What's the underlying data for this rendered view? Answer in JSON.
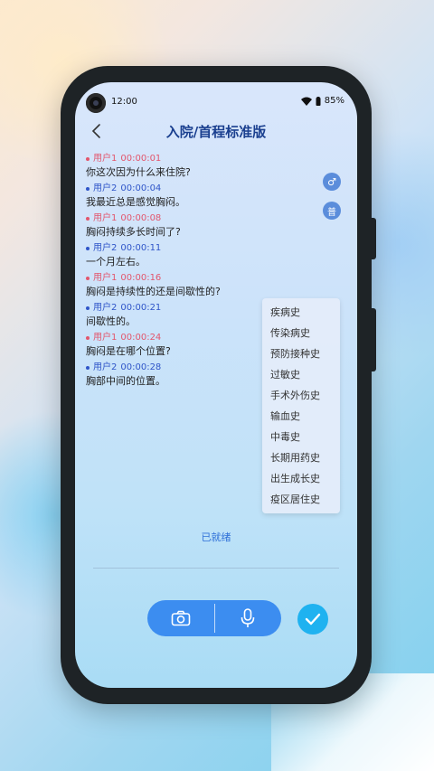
{
  "status_bar": {
    "time": "12:00",
    "battery": "85%"
  },
  "header": {
    "title": "入院/首程标准版"
  },
  "messages": [
    {
      "speaker": "用户1",
      "time": "00:00:01",
      "text": "你这次因为什么来住院?"
    },
    {
      "speaker": "用户2",
      "time": "00:00:04",
      "text": "我最近总是感觉胸闷。"
    },
    {
      "speaker": "用户1",
      "time": "00:00:08",
      "text": "胸闷持续多长时间了?"
    },
    {
      "speaker": "用户2",
      "time": "00:00:11",
      "text": "一个月左右。"
    },
    {
      "speaker": "用户1",
      "time": "00:00:16",
      "text": "胸闷是持续性的还是间歇性的?"
    },
    {
      "speaker": "用户2",
      "time": "00:00:21",
      "text": "间歇性的。"
    },
    {
      "speaker": "用户1",
      "time": "00:00:24",
      "text": "胸闷是在哪个位置?"
    },
    {
      "speaker": "用户2",
      "time": "00:00:28",
      "text": "胸部中间的位置。"
    }
  ],
  "side_icons": {
    "gender_symbol": "♂",
    "general_symbol": "普"
  },
  "history_menu": [
    "疾病史",
    "传染病史",
    "预防接种史",
    "过敏史",
    "手术外伤史",
    "输血史",
    "中毒史",
    "长期用药史",
    "出生成长史",
    "疫区居住史"
  ],
  "status_text": "已就绪",
  "colors": {
    "user1": "#e2566d",
    "user2": "#2f55c8",
    "accent": "#3c8df0",
    "confirm": "#1fb2f0"
  },
  "icons": [
    "back-icon",
    "camera-icon",
    "microphone-icon",
    "check-icon",
    "wifi-icon",
    "battery-icon",
    "male-icon"
  ]
}
